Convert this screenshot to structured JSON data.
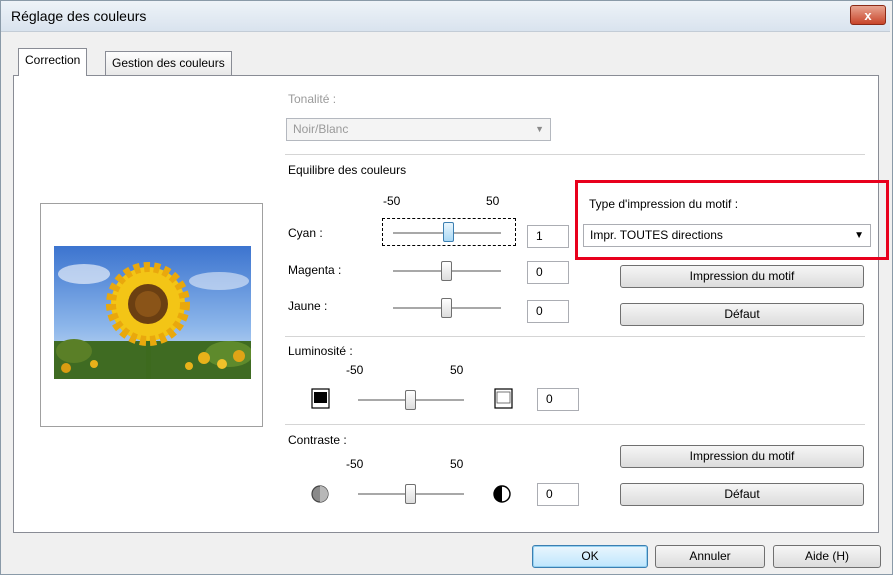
{
  "window": {
    "title": "Réglage des couleurs",
    "close_glyph": "x"
  },
  "tabs": [
    {
      "label": "Correction"
    },
    {
      "label": "Gestion des couleurs"
    }
  ],
  "tone": {
    "label": "Tonalité :",
    "value": "Noir/Blanc"
  },
  "balance": {
    "label": "Equilibre des couleurs",
    "scale_min": "-50",
    "scale_max": "50",
    "cyan": {
      "label": "Cyan :",
      "value": "1",
      "level": 1
    },
    "magenta": {
      "label": "Magenta :",
      "value": "0",
      "level": 0
    },
    "yellow": {
      "label": "Jaune :",
      "value": "0",
      "level": 0
    }
  },
  "pattern": {
    "label": "Type d'impression du motif :",
    "value": "Impr. TOUTES directions",
    "print_button": "Impression du motif",
    "default_button": "Défaut"
  },
  "brightness": {
    "label": "Luminosité :",
    "scale_min": "-50",
    "scale_max": "50",
    "value": "0",
    "level": 0
  },
  "contrast": {
    "label": "Contraste :",
    "scale_min": "-50",
    "scale_max": "50",
    "value": "0",
    "level": 0,
    "print_button": "Impression du motif",
    "default_button": "Défaut"
  },
  "footer": {
    "ok": "OK",
    "cancel": "Annuler",
    "help": "Aide (H)"
  },
  "colors": {
    "highlight": "#e8001c",
    "title_close": "#c8452a"
  }
}
